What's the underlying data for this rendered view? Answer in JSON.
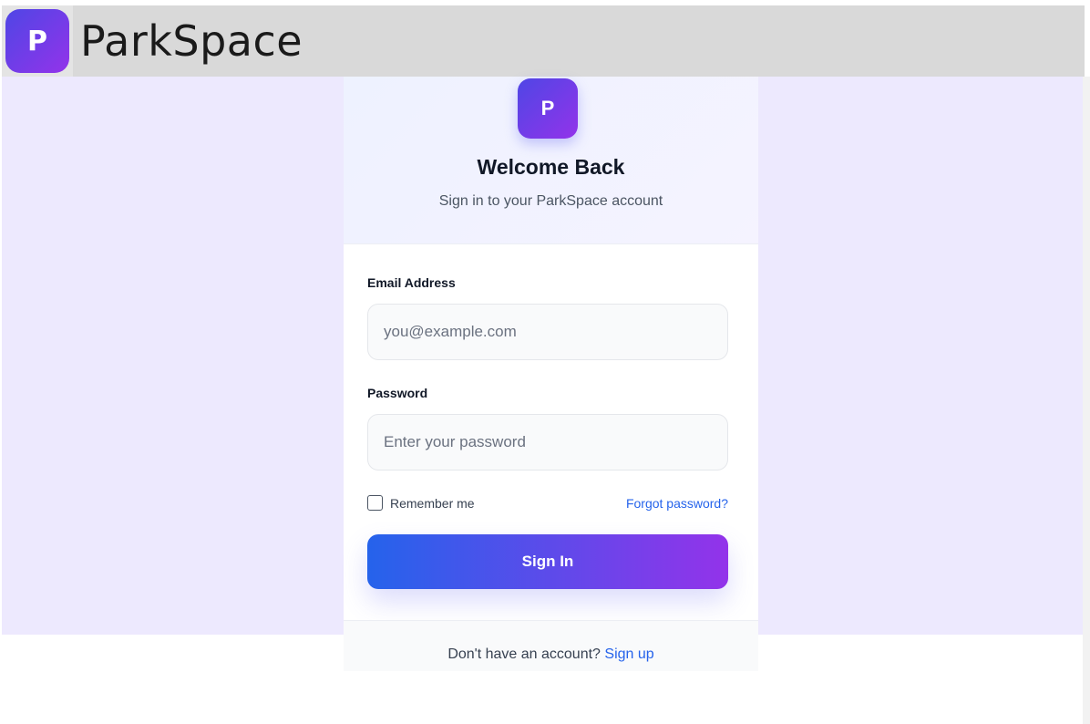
{
  "app": {
    "logo_letter": "P",
    "name": "ParkSpace"
  },
  "card": {
    "logo_letter": "P",
    "title": "Welcome Back",
    "subtitle": "Sign in to your ParkSpace account"
  },
  "form": {
    "email": {
      "label": "Email Address",
      "placeholder": "you@example.com",
      "value": ""
    },
    "password": {
      "label": "Password",
      "placeholder": "Enter your password",
      "value": ""
    },
    "remember_label": "Remember me",
    "remember_checked": false,
    "forgot_label": "Forgot password?",
    "submit_label": "Sign In"
  },
  "footer": {
    "prompt": "Don't have an account?",
    "signup_label": "Sign up"
  },
  "colors": {
    "accent_start": "#2563eb",
    "accent_end": "#9333ea",
    "link": "#2563eb",
    "page_bg": "#ede9fe"
  }
}
